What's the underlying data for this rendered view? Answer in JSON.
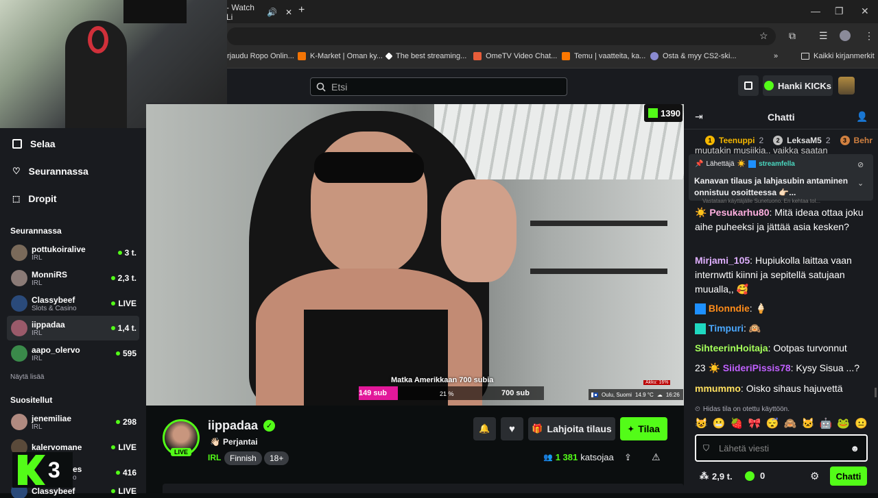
{
  "browser": {
    "tab_title": "- Watch Li",
    "bookmarks": [
      {
        "label": "rjaudu Ropo Onlin...",
        "color": "#ff6a00"
      },
      {
        "label": "K-Market | Oman ky...",
        "color": "#f27405"
      },
      {
        "label": "The best streaming...",
        "color": "#ffffff"
      },
      {
        "label": "OmeTV Video Chat...",
        "color": "#e85d3a"
      },
      {
        "label": "Temu | vaatteita, ka...",
        "color": "#fb7701"
      },
      {
        "label": "Osta & myy CS2-ski...",
        "color": "#8a8ad0"
      }
    ],
    "bookmarks_more": "»",
    "all_bookmarks": "Kaikki kirjanmerkit"
  },
  "header": {
    "search_placeholder": "Etsi",
    "get_kicks_label": "Hanki KICKs"
  },
  "sidebar": {
    "nav": [
      {
        "label": "Selaa",
        "icon": "browse-icon"
      },
      {
        "label": "Seurannassa",
        "icon": "heart-icon"
      },
      {
        "label": "Dropit",
        "icon": "drops-icon"
      }
    ],
    "following_title": "Seurannassa",
    "following": [
      {
        "name": "pottukoiralive",
        "category": "IRL",
        "viewers": "3 t.",
        "avatar": "#7a6a5a"
      },
      {
        "name": "MonniRS",
        "category": "IRL",
        "viewers": "2,3 t.",
        "avatar": "#8a7a76"
      },
      {
        "name": "Classybeef",
        "category": "Slots & Casino",
        "viewers": "LIVE",
        "avatar": "#2a4a7a"
      },
      {
        "name": "iippadaa",
        "category": "IRL",
        "viewers": "1,4 t.",
        "avatar": "#9a5a6a"
      },
      {
        "name": "aapo_olervo",
        "category": "IRL",
        "viewers": "595",
        "avatar": "#3a8a4a"
      }
    ],
    "show_more": "Näytä lisää",
    "recommended_title": "Suositellut",
    "recommended": [
      {
        "name": "jenemiliae",
        "category": "IRL",
        "viewers": "298",
        "avatar": "#b08a80"
      },
      {
        "name": "kalervomane",
        "category": "",
        "viewers": "LIVE",
        "avatar": "#5a4a3a"
      },
      {
        "name": "es",
        "category": "o",
        "viewers": "416",
        "avatar": "#444"
      },
      {
        "name": "Classybeef",
        "category": "",
        "viewers": "LIVE",
        "avatar": "#2a4a7a"
      }
    ],
    "kick_badge": "3"
  },
  "video": {
    "kick_counter": "1390",
    "goal_title": "Matka Amerikkaan 700 subia",
    "goal_current": "149 sub",
    "goal_percent_label": "21 %",
    "goal_target": "700 sub",
    "goal_progress": 0.21,
    "battery": "Akku: 16%",
    "location": "Oulu, Suomi",
    "temperature": "14.9 °C",
    "time": "16:26"
  },
  "stream": {
    "channel": "iippadaa",
    "live_badge": "LIVE",
    "title_prefix": "👋🏻",
    "title": "Perjantai",
    "category": "IRL",
    "tags": [
      "Finnish",
      "18+"
    ],
    "gift_label": "Lahjoita tilaus",
    "subscribe_label": "Tilaa",
    "viewers_count": "1 381",
    "viewers_label": "katsojaa"
  },
  "chat": {
    "title": "Chatti",
    "leaderboard": [
      {
        "rank": "1",
        "name": "Teenuppi",
        "count": "2",
        "color": "#f5b700"
      },
      {
        "rank": "2",
        "name": "LeksaM5",
        "count": "2",
        "color": "#c0c0c0"
      },
      {
        "rank": "3",
        "name": "Behr",
        "count": "",
        "color": "#d08040"
      }
    ],
    "partial_line": "muutakin musiikia,, vaikka saatan",
    "pinned_sender_label": "Lähettäjä",
    "pinned_sender": "streamfella",
    "pinned_text": "Kanavan tilaus ja lahjasubin antaminen onnistuu osoitteessa 👉🏻...",
    "reply_hint": "Vastataan käyttäjälle Sunetuono. En kehtaa tol...",
    "messages": [
      {
        "user": "Pesukarhu80",
        "color": "#ffb0e0",
        "badge": "☀️",
        "text": "Mitä ideaa ottaa joku aihe puheeksi ja jättää asia kesken?"
      },
      {
        "user": "Mirjami_105",
        "color": "#e0b0ff",
        "badge": "",
        "text": "Hupiukolla laittaa vaan internwtti kiinni ja sepitellä satujaan muualla,, 🥰"
      },
      {
        "user": "Blonndie",
        "color": "#ff8c1a",
        "badge": "",
        "text": "🍦"
      },
      {
        "user": "Timpuri",
        "color": "#4aa8ff",
        "badge": "",
        "text": "🙉"
      },
      {
        "user": "SihteerinHoitaja",
        "color": "#a4ff5a",
        "badge": "",
        "text": "Ootpas turvonnut"
      },
      {
        "user": "SiideriPissis78",
        "color": "#c060ff",
        "badge": "23 ☀️",
        "text": "Kysy Sisua ...?"
      },
      {
        "user": "mmummo",
        "color": "#ffe060",
        "badge": "",
        "text": "Oisko sihaus hajuvettä"
      }
    ],
    "slow_mode": "Hidas tila on otettu käyttöön.",
    "emotes": [
      "😺",
      "😬",
      "🍓",
      "🎀",
      "😴",
      "🙈",
      "🐱",
      "🤖",
      "🐸",
      "😐"
    ],
    "input_placeholder": "Lähetä viesti",
    "kicks_balance": "2,9 t.",
    "points": "0",
    "send_label": "Chatti"
  }
}
